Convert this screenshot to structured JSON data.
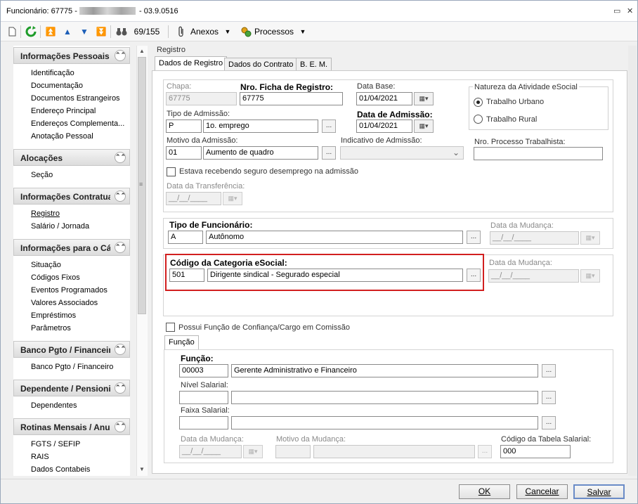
{
  "window": {
    "title_prefix": "Funcionário: 67775 -",
    "title_suffix": "- 03.9.0516",
    "restore_icon": "restore-icon",
    "close_icon": "close-icon"
  },
  "toolbar": {
    "record_counter": "69/155",
    "attachments_label": "Anexos",
    "processes_label": "Processos"
  },
  "sidebar": {
    "groups": [
      {
        "title": "Informações Pessoais",
        "items": [
          "Identificação",
          "Documentação",
          "Documentos Estrangeiros",
          "Endereço Principal",
          "Endereços Complementa...",
          "Anotação Pessoal"
        ]
      },
      {
        "title": "Alocações",
        "items": [
          "Seção"
        ]
      },
      {
        "title": "Informações Contratua",
        "items": [
          "Registro",
          "Salário / Jornada"
        ]
      },
      {
        "title": "Informações para o Cál",
        "items": [
          "Situação",
          "Códigos Fixos",
          "Eventos Programados",
          "Valores Associados",
          "Empréstimos",
          "Parâmetros"
        ]
      },
      {
        "title": "Banco Pgto / Financeiro",
        "items": [
          "Banco Pgto / Financeiro"
        ]
      },
      {
        "title": "Dependente / Pensionis",
        "items": [
          "Dependentes"
        ]
      },
      {
        "title": "Rotinas Mensais / Anua",
        "items": [
          "FGTS / SEFIP",
          "RAIS",
          "Dados Contabeis"
        ]
      }
    ]
  },
  "main": {
    "section_title": "Registro",
    "tabs": [
      "Dados de Registro",
      "Dados do Contrato",
      "B. E. M."
    ],
    "chapa_label": "Chapa:",
    "chapa_value": "67775",
    "ficha_label": "Nro. Ficha de Registro:",
    "ficha_value": "67775",
    "data_base_label": "Data Base:",
    "data_base_value": "01/04/2021",
    "natureza_label": "Natureza da Atividade eSocial",
    "natureza_options": [
      "Trabalho Urbano",
      "Trabalho Rural"
    ],
    "tipo_admissao_label": "Tipo de Admissão:",
    "tipo_admissao_code": "P",
    "tipo_admissao_desc": "1o. emprego",
    "data_admissao_label": "Data de Admissão:",
    "data_admissao_value": "01/04/2021",
    "motivo_admissao_label": "Motivo da Admissão:",
    "motivo_admissao_code": "01",
    "motivo_admissao_desc": "Aumento de quadro",
    "indicativo_label": "Indicativo de Admissão:",
    "processo_label": "Nro. Processo Trabalhista:",
    "seguro_label": "Estava recebendo seguro desemprego na admissão",
    "data_transferencia_label": "Data da Transferência:",
    "date_placeholder": "__/__/____",
    "tipo_func_label": "Tipo de Funcionário:",
    "tipo_func_code": "A",
    "tipo_func_desc": "Autônomo",
    "data_mudanca_label": "Data da Mudança:",
    "categoria_label": "Código da Categoria eSocial:",
    "categoria_code": "501",
    "categoria_desc": "Dirigente sindical - Segurado especial",
    "funcao_confianca_label": "Possui Função de Confiança/Cargo em Comissão",
    "funcao_tab": "Função",
    "funcao_label": "Função:",
    "funcao_code": "00003",
    "funcao_desc": "Gerente Administrativo e Financeiro",
    "nivel_label": "Nível Salarial:",
    "faixa_label": "Faixa Salarial:",
    "motivo_mudanca_label": "Motivo da Mudança:",
    "tabela_label": "Código da Tabela Salarial:",
    "tabela_value": "000",
    "lookup_label": "...",
    "dropdown_glyph": "▾"
  },
  "footer": {
    "ok": "OK",
    "cancel": "Cancelar",
    "save": "Salvar"
  },
  "colors": {
    "highlight_border": "#d21f1f",
    "group_header_bg": "#e2e2e2"
  }
}
